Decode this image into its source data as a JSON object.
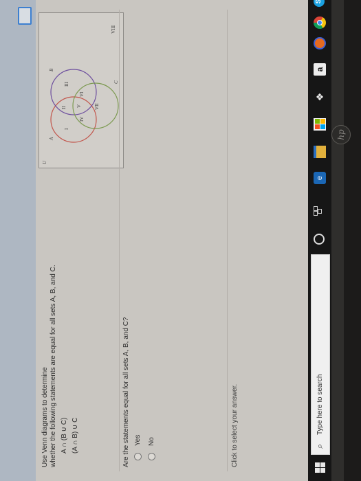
{
  "question": {
    "instruction_line1": "Use Venn diagrams to determine",
    "instruction_line2": "whether the following statements are equal for all sets A, B, and C.",
    "statement1": "A ∩ (B ∪ C)",
    "statement2": "(A ∩ B) ∪ C"
  },
  "venn": {
    "universe_label": "U",
    "set_labels": [
      "A",
      "B",
      "C"
    ],
    "region_labels": [
      "I",
      "II",
      "III",
      "IV",
      "V",
      "VI",
      "VII",
      "VIII"
    ],
    "circle_colors": {
      "A": "#c2554b",
      "B": "#6d4e9e",
      "C": "#7d9a52"
    }
  },
  "prompt": "Are the statements equal for all sets A, B, and C?",
  "options": [
    "Yes",
    "No"
  ],
  "click_hint": "Click to select your answer.",
  "taskbar": {
    "search_placeholder": "Type here to search",
    "search_icon": "search-icon",
    "apps": [
      "cortana-icon",
      "task-view-icon",
      "edge-icon",
      "file-explorer-icon",
      "store-icon",
      "dropbox-icon",
      "amazon-icon",
      "firefox-icon",
      "chrome-icon",
      "skype-icon"
    ],
    "amazon_glyph": "a",
    "skype_glyph": "S"
  },
  "brand": "hp"
}
